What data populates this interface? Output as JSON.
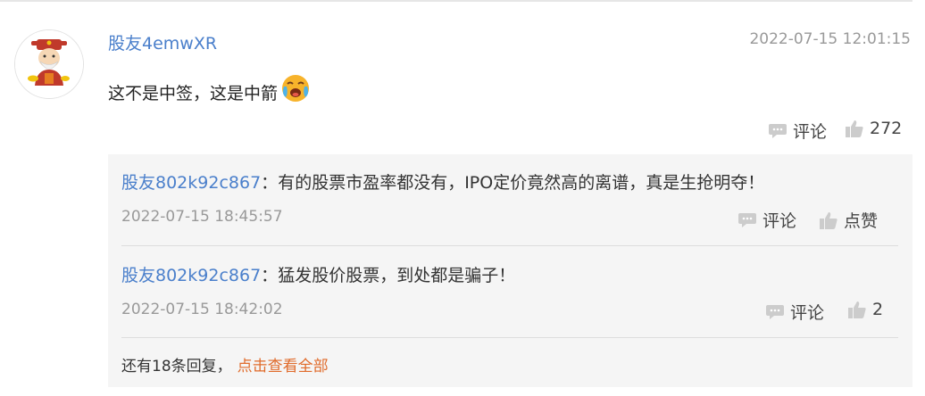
{
  "comment": {
    "username": "股友4emwXR",
    "timestamp": "2022-07-15 12:01:15",
    "text": "这不是中签，这是中箭",
    "emoji_icon": "crying-face-icon",
    "comment_label": "评论",
    "like_count": "272"
  },
  "replies": [
    {
      "username": "股友802k92c867",
      "separator": "：",
      "text": "有的股票市盈率都没有，IPO定价竟然高的离谱，真是生抢明夺！",
      "timestamp": "2022-07-15 18:45:57",
      "comment_label": "评论",
      "like_label": "点赞"
    },
    {
      "username": "股友802k92c867",
      "separator": "：",
      "text": "猛发股价股票，到处都是骗子！",
      "timestamp": "2022-07-15 18:42:02",
      "comment_label": "评论",
      "like_label": "2"
    }
  ],
  "more": {
    "text": "还有18条回复，",
    "link": "点击查看全部"
  },
  "colors": {
    "username": "#4a7fcb",
    "link": "#e06b2b",
    "reply_bg": "#f5f5f5",
    "muted": "#999999"
  }
}
